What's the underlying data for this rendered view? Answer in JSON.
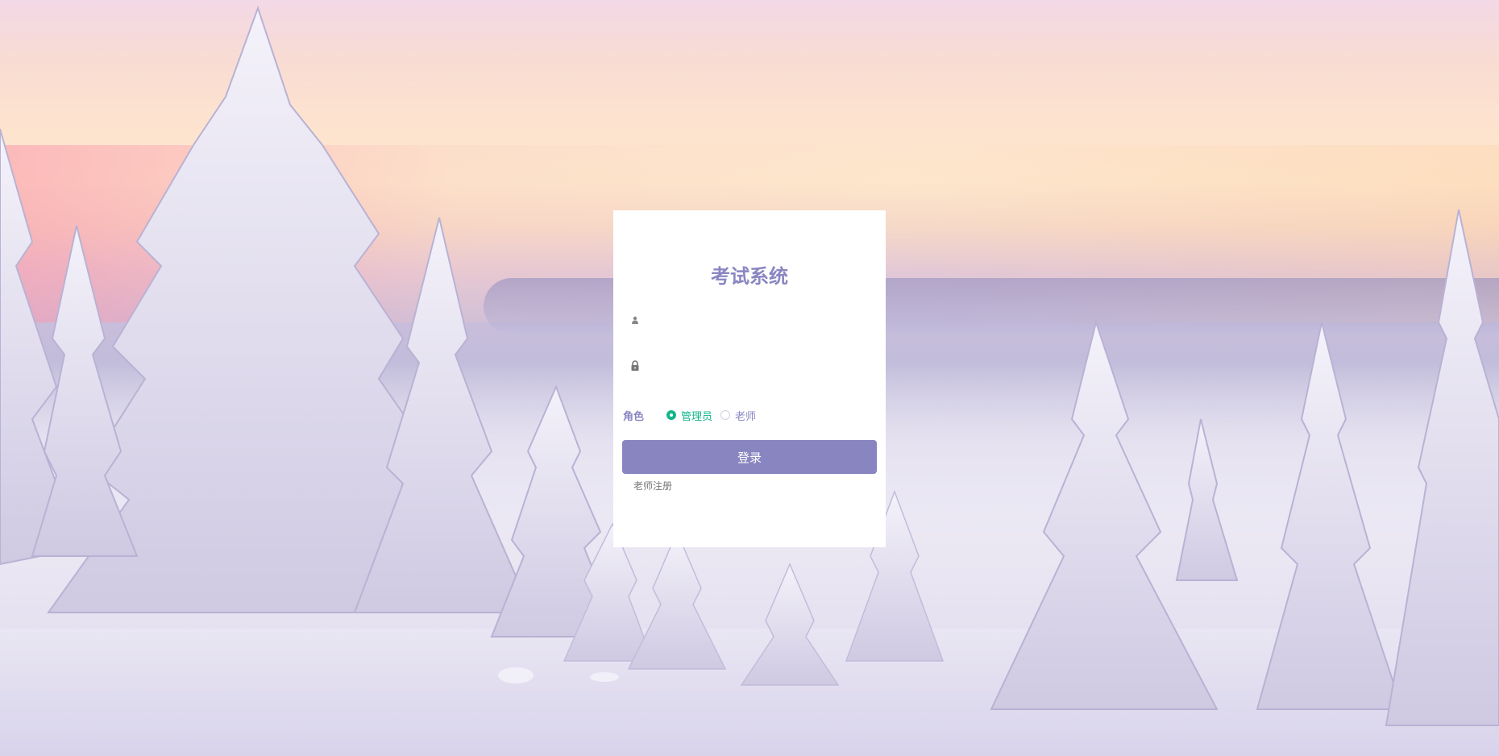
{
  "login": {
    "title": "考试系统",
    "username": {
      "value": "",
      "placeholder": ""
    },
    "password": {
      "value": "",
      "placeholder": ""
    },
    "role_label": "角色",
    "roles": [
      {
        "label": "管理员",
        "checked": true
      },
      {
        "label": "老师",
        "checked": false
      }
    ],
    "login_button": "登录",
    "register_link": "老师注册"
  },
  "icons": {
    "username": "user-icon",
    "password": "lock-icon"
  },
  "colors": {
    "accent": "#8985c0",
    "title": "#8a86c2",
    "radio_checked": "#13b58a"
  }
}
